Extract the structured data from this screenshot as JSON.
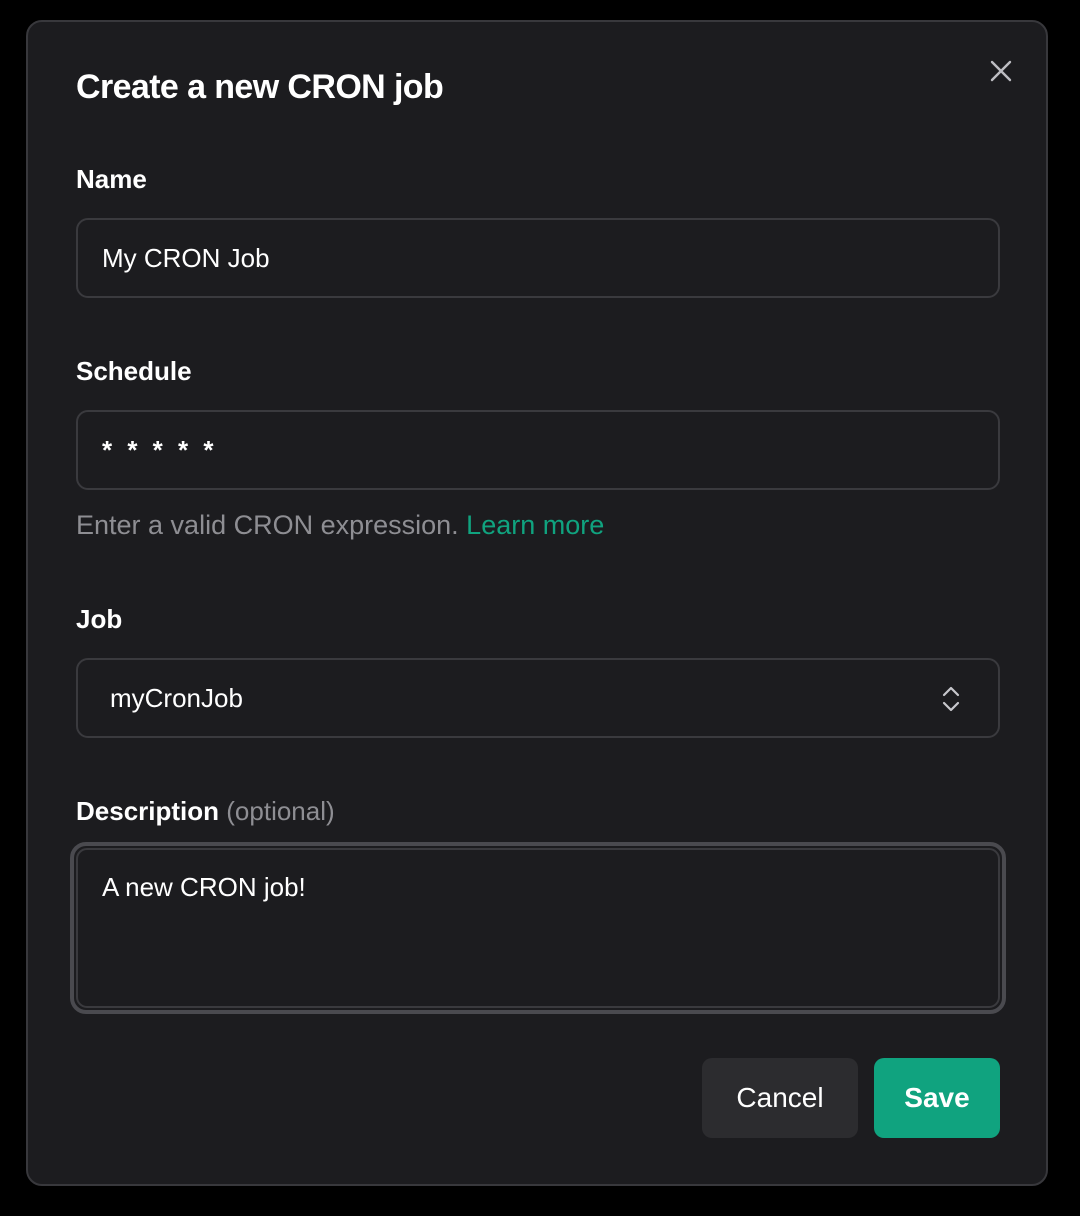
{
  "dialog": {
    "title": "Create a new CRON job",
    "close_icon": "close-icon"
  },
  "fields": {
    "name": {
      "label": "Name",
      "value": "My CRON Job"
    },
    "schedule": {
      "label": "Schedule",
      "value": "* * * * *",
      "hint": "Enter a valid CRON expression.",
      "hint_link": "Learn more"
    },
    "job": {
      "label": "Job",
      "value": "myCronJob",
      "icon": "chevron-up-down-icon"
    },
    "description": {
      "label": "Description",
      "optional": "(optional)",
      "value": "A new CRON job!"
    }
  },
  "actions": {
    "cancel_label": "Cancel",
    "save_label": "Save"
  },
  "colors": {
    "accent": "#10a37f",
    "background": "#1c1c1f",
    "border": "#3a3a3e",
    "muted": "#8e8e93"
  }
}
